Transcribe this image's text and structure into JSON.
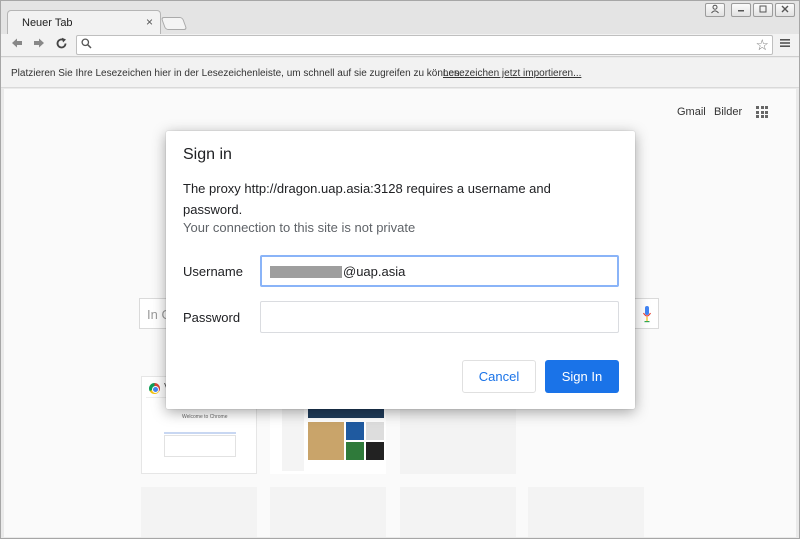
{
  "tab": {
    "title": "Neuer Tab",
    "close_glyph": "×"
  },
  "toolbar": {
    "omnibox_value": ""
  },
  "bookmark_bar": {
    "text": "Platzieren Sie Ihre Lesezeichen hier in der Lesezeichenleiste, um schnell auf sie zugreifen zu können.",
    "import_link": "Lesezeichen jetzt importieren..."
  },
  "ntp": {
    "gmail": "Gmail",
    "images": "Bilder",
    "search_placeholder": "In G",
    "tile1_letter": "V",
    "tile1_preview_title": "Welcome to Chrome"
  },
  "dialog": {
    "title": "Sign in",
    "message": "The proxy http://dragon.uap.asia:3128 requires a username and password.",
    "warning": "Your connection to this site is not private",
    "username_label": "Username",
    "username_value_visible": "@uap.asia",
    "password_label": "Password",
    "password_value": "",
    "cancel_label": "Cancel",
    "signin_label": "Sign In",
    "colors": {
      "primary": "#1a73e8",
      "focus_ring": "#8ab4f8"
    }
  }
}
